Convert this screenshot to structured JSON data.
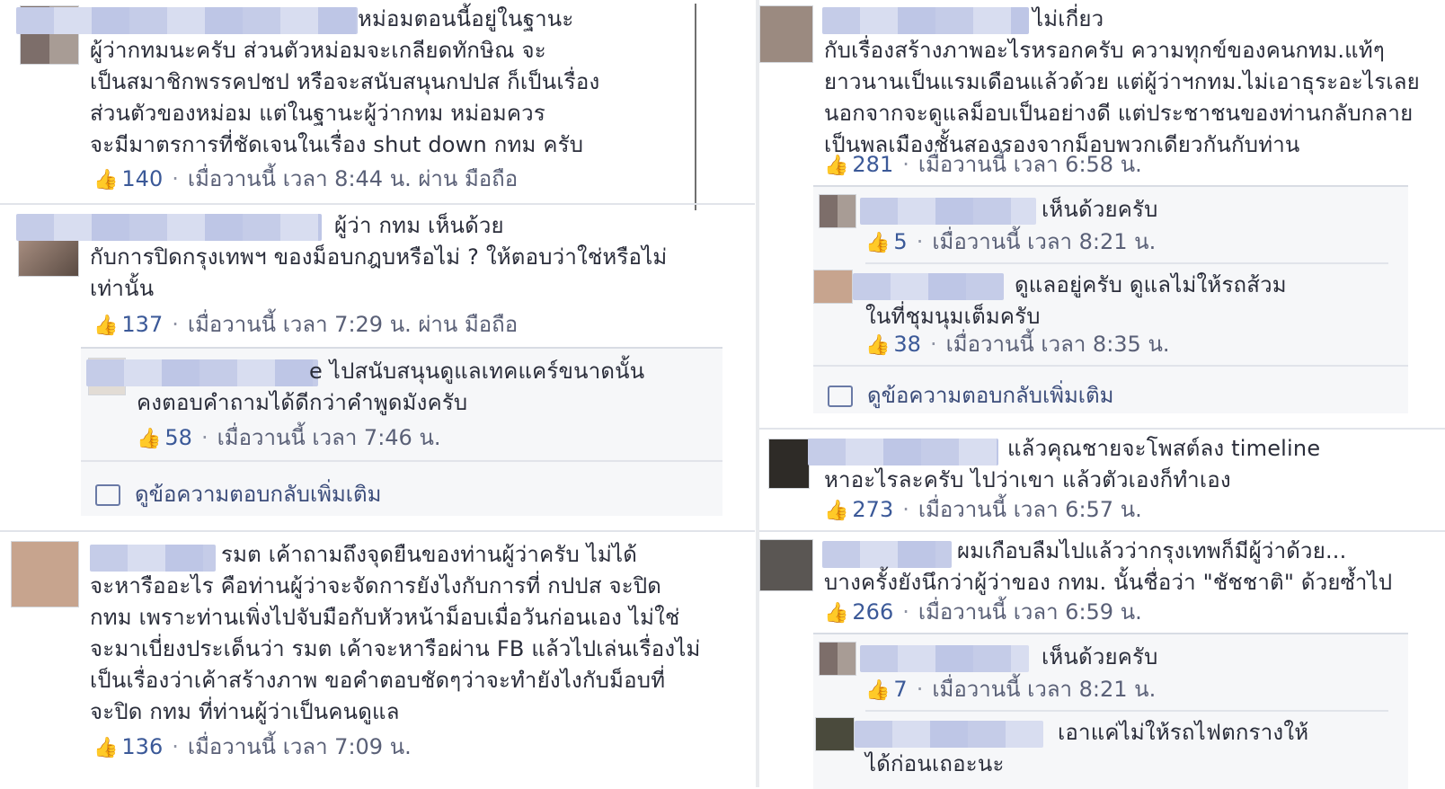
{
  "left": {
    "comments": [
      {
        "lines": [
          "หม่อมตอนนี้อยู่ในฐานะ",
          "ผู้ว่ากทมนะครับ ส่วนตัวหม่อมจะเกลียดทักษิณ จะ",
          "เป็นสมาชิกพรรคปชป หรือจะสนับสนุนกปปส ก็เป็นเรื่อง",
          "ส่วนตัวของหม่อม แต่ในฐานะผู้ว่ากทม หม่อมควร",
          "จะมีมาตรการที่ชัดเจนในเรื่อง shut down กทม ครับ"
        ],
        "likes": "140",
        "time": "เมื่อวานนี้ เวลา 8:44 น. ผ่าน มือถือ"
      },
      {
        "lines": [
          "ผู้ว่า กทม เห็นด้วย",
          "กับการปิดกรุงเทพฯ ของม็อบกฎบหรือไม่ ? ให้ตอบว่าใช่หรือไม่",
          "เท่านั้น"
        ],
        "likes": "137",
        "time": "เมื่อวานนี้ เวลา 7:29 น. ผ่าน มือถือ",
        "replies": [
          {
            "lines": [
              "e ไปสนับสนุนดูแลเทคแคร์ขนาดนั้น",
              "คงตอบคำถามได้ดีกว่าคำพูดมังครับ"
            ],
            "likes": "58",
            "time": "เมื่อวานนี้ เวลา 7:46 น."
          }
        ],
        "more": "ดูข้อความตอบกลับเพิ่มเติม"
      },
      {
        "lines": [
          "รมต เค้าถามถึงจุดยืนของท่านผู้ว่าครับ ไม่ได้",
          "จะหารืออะไร คือท่านผู้ว่าจะจัดการยังไงกับการที่ กปปส จะปิด",
          "กทม เพราะท่านเพิ่งไปจับมือกับหัวหน้าม็อบเมื่อวันก่อนเอง ไม่ใช่",
          "จะมาเบี่ยงประเด็นว่า รมต เค้าจะหารือผ่าน FB แล้วไปเล่นเรื่องไม่",
          "เป็นเรื่องว่าเค้าสร้างภาพ ขอคำตอบชัดๆว่าจะทำยังไงกับม็อบที่",
          "จะปิด กทม ที่ท่านผู้ว่าเป็นคนดูแล"
        ],
        "likes": "136",
        "time": "เมื่อวานนี้ เวลา 7:09 น."
      }
    ]
  },
  "right": {
    "comments": [
      {
        "lines": [
          "ไม่เกี่ยว",
          "กับเรื่องสร้างภาพอะไรหรอกครับ ความทุกข์ของคนกทม.แท้ๆ",
          "ยาวนานเป็นแรมเดือนแล้วด้วย แต่ผู้ว่าฯกทม.ไม่เอาธุระอะไรเลย",
          "นอกจากจะดูแลม็อบเป็นอย่างดี แต่ประชาชนของท่านกลับกลาย",
          "เป็นพลเมืองชั้นสองรองจากม็อบพวกเดียวกันกับท่าน"
        ],
        "likes": "281",
        "time": "เมื่อวานนี้ เวลา 6:58 น.",
        "replies": [
          {
            "lines": [
              "เห็นด้วยครับ"
            ],
            "likes": "5",
            "time": "เมื่อวานนี้ เวลา 8:21 น."
          },
          {
            "lines": [
              "ดูแลอยู่ครับ ดูแลไม่ให้รถส้วม",
              "ในที่ชุมนุมเต็มครับ"
            ],
            "likes": "38",
            "time": "เมื่อวานนี้ เวลา 8:35 น."
          }
        ],
        "more": "ดูข้อความตอบกลับเพิ่มเติม"
      },
      {
        "lines": [
          "แล้วคุณชายจะโพสต์ลง timeline",
          "หาอะไรละครับ ไปว่าเขา แล้วตัวเองก็ทำเอง"
        ],
        "likes": "273",
        "time": "เมื่อวานนี้ เวลา 6:57 น."
      },
      {
        "lines": [
          "ผมเกือบลืมไปแล้วว่ากรุงเทพก็มีผู้ว่าด้วย...",
          "บางครั้งยังนึกว่าผู้ว่าของ กทม. นั้นชื่อว่า \"ชัชชาติ\" ด้วยซ้ำไป"
        ],
        "likes": "266",
        "time": "เมื่อวานนี้ เวลา 6:59 น.",
        "replies": [
          {
            "lines": [
              "เห็นด้วยครับ"
            ],
            "likes": "7",
            "time": "เมื่อวานนี้ เวลา 8:21 น."
          },
          {
            "lines": [
              "เอาแค่ไม่ให้รถไฟตกรางให้",
              "ได้ก่อนเถอะนะ"
            ]
          }
        ]
      }
    ]
  }
}
